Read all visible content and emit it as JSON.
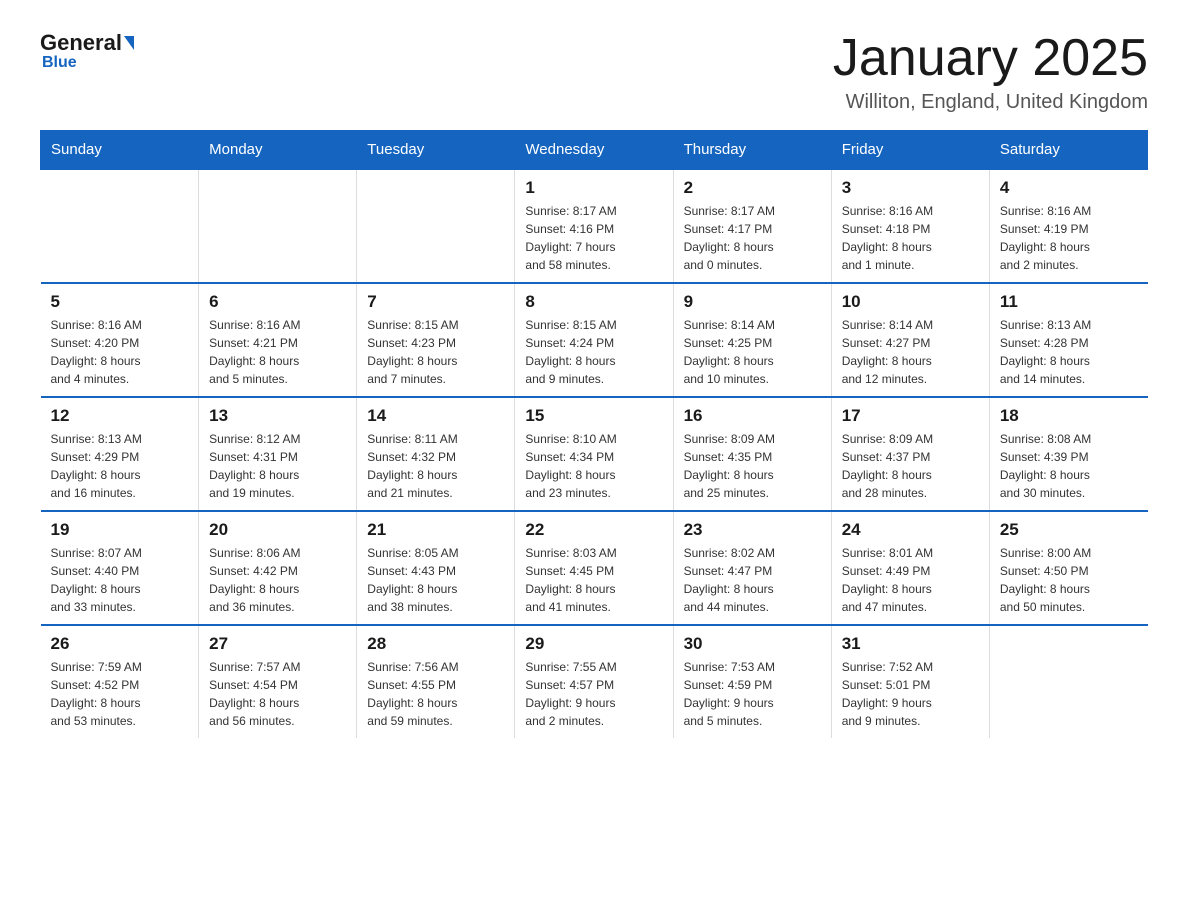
{
  "header": {
    "title": "January 2025",
    "location": "Williton, England, United Kingdom",
    "logo_general": "General",
    "logo_blue": "Blue"
  },
  "days_of_week": [
    "Sunday",
    "Monday",
    "Tuesday",
    "Wednesday",
    "Thursday",
    "Friday",
    "Saturday"
  ],
  "weeks": [
    [
      {
        "day": "",
        "info": ""
      },
      {
        "day": "",
        "info": ""
      },
      {
        "day": "",
        "info": ""
      },
      {
        "day": "1",
        "info": "Sunrise: 8:17 AM\nSunset: 4:16 PM\nDaylight: 7 hours\nand 58 minutes."
      },
      {
        "day": "2",
        "info": "Sunrise: 8:17 AM\nSunset: 4:17 PM\nDaylight: 8 hours\nand 0 minutes."
      },
      {
        "day": "3",
        "info": "Sunrise: 8:16 AM\nSunset: 4:18 PM\nDaylight: 8 hours\nand 1 minute."
      },
      {
        "day": "4",
        "info": "Sunrise: 8:16 AM\nSunset: 4:19 PM\nDaylight: 8 hours\nand 2 minutes."
      }
    ],
    [
      {
        "day": "5",
        "info": "Sunrise: 8:16 AM\nSunset: 4:20 PM\nDaylight: 8 hours\nand 4 minutes."
      },
      {
        "day": "6",
        "info": "Sunrise: 8:16 AM\nSunset: 4:21 PM\nDaylight: 8 hours\nand 5 minutes."
      },
      {
        "day": "7",
        "info": "Sunrise: 8:15 AM\nSunset: 4:23 PM\nDaylight: 8 hours\nand 7 minutes."
      },
      {
        "day": "8",
        "info": "Sunrise: 8:15 AM\nSunset: 4:24 PM\nDaylight: 8 hours\nand 9 minutes."
      },
      {
        "day": "9",
        "info": "Sunrise: 8:14 AM\nSunset: 4:25 PM\nDaylight: 8 hours\nand 10 minutes."
      },
      {
        "day": "10",
        "info": "Sunrise: 8:14 AM\nSunset: 4:27 PM\nDaylight: 8 hours\nand 12 minutes."
      },
      {
        "day": "11",
        "info": "Sunrise: 8:13 AM\nSunset: 4:28 PM\nDaylight: 8 hours\nand 14 minutes."
      }
    ],
    [
      {
        "day": "12",
        "info": "Sunrise: 8:13 AM\nSunset: 4:29 PM\nDaylight: 8 hours\nand 16 minutes."
      },
      {
        "day": "13",
        "info": "Sunrise: 8:12 AM\nSunset: 4:31 PM\nDaylight: 8 hours\nand 19 minutes."
      },
      {
        "day": "14",
        "info": "Sunrise: 8:11 AM\nSunset: 4:32 PM\nDaylight: 8 hours\nand 21 minutes."
      },
      {
        "day": "15",
        "info": "Sunrise: 8:10 AM\nSunset: 4:34 PM\nDaylight: 8 hours\nand 23 minutes."
      },
      {
        "day": "16",
        "info": "Sunrise: 8:09 AM\nSunset: 4:35 PM\nDaylight: 8 hours\nand 25 minutes."
      },
      {
        "day": "17",
        "info": "Sunrise: 8:09 AM\nSunset: 4:37 PM\nDaylight: 8 hours\nand 28 minutes."
      },
      {
        "day": "18",
        "info": "Sunrise: 8:08 AM\nSunset: 4:39 PM\nDaylight: 8 hours\nand 30 minutes."
      }
    ],
    [
      {
        "day": "19",
        "info": "Sunrise: 8:07 AM\nSunset: 4:40 PM\nDaylight: 8 hours\nand 33 minutes."
      },
      {
        "day": "20",
        "info": "Sunrise: 8:06 AM\nSunset: 4:42 PM\nDaylight: 8 hours\nand 36 minutes."
      },
      {
        "day": "21",
        "info": "Sunrise: 8:05 AM\nSunset: 4:43 PM\nDaylight: 8 hours\nand 38 minutes."
      },
      {
        "day": "22",
        "info": "Sunrise: 8:03 AM\nSunset: 4:45 PM\nDaylight: 8 hours\nand 41 minutes."
      },
      {
        "day": "23",
        "info": "Sunrise: 8:02 AM\nSunset: 4:47 PM\nDaylight: 8 hours\nand 44 minutes."
      },
      {
        "day": "24",
        "info": "Sunrise: 8:01 AM\nSunset: 4:49 PM\nDaylight: 8 hours\nand 47 minutes."
      },
      {
        "day": "25",
        "info": "Sunrise: 8:00 AM\nSunset: 4:50 PM\nDaylight: 8 hours\nand 50 minutes."
      }
    ],
    [
      {
        "day": "26",
        "info": "Sunrise: 7:59 AM\nSunset: 4:52 PM\nDaylight: 8 hours\nand 53 minutes."
      },
      {
        "day": "27",
        "info": "Sunrise: 7:57 AM\nSunset: 4:54 PM\nDaylight: 8 hours\nand 56 minutes."
      },
      {
        "day": "28",
        "info": "Sunrise: 7:56 AM\nSunset: 4:55 PM\nDaylight: 8 hours\nand 59 minutes."
      },
      {
        "day": "29",
        "info": "Sunrise: 7:55 AM\nSunset: 4:57 PM\nDaylight: 9 hours\nand 2 minutes."
      },
      {
        "day": "30",
        "info": "Sunrise: 7:53 AM\nSunset: 4:59 PM\nDaylight: 9 hours\nand 5 minutes."
      },
      {
        "day": "31",
        "info": "Sunrise: 7:52 AM\nSunset: 5:01 PM\nDaylight: 9 hours\nand 9 minutes."
      },
      {
        "day": "",
        "info": ""
      }
    ]
  ]
}
